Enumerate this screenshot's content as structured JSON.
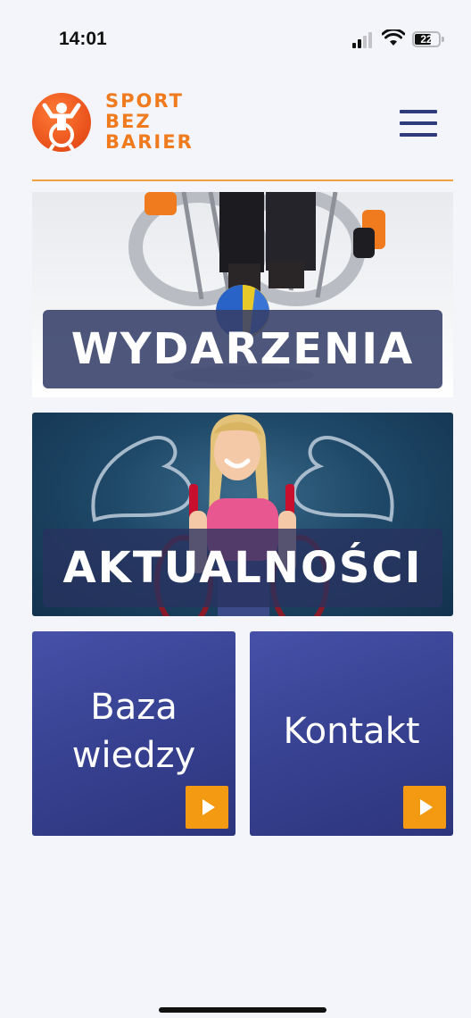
{
  "status_bar": {
    "time": "14:01",
    "battery": "22",
    "icons": [
      "signal-icon",
      "wifi-icon",
      "battery-icon"
    ]
  },
  "header": {
    "logo_lines": [
      "SPORT",
      "BEZ",
      "BARIER"
    ],
    "logo_icon": "athlete-wheelchair-icon",
    "menu_icon": "hamburger-menu-icon",
    "accent_color": "#f07a1e",
    "brand_color": "#2f3b7a"
  },
  "tiles": [
    {
      "label": "WYDARZENIA",
      "image": "wheelchair-athlete-ball-photo"
    },
    {
      "label": "AKTUALNOŚCI",
      "image": "girl-wheelchair-muscles-photo"
    }
  ],
  "boxes": [
    {
      "label_lines": [
        "Baza",
        "wiedzy"
      ],
      "arrow_icon": "play-arrow-icon"
    },
    {
      "label_lines": [
        "Kontakt"
      ],
      "arrow_icon": "play-arrow-icon"
    }
  ],
  "colors": {
    "box_blue": "#3a4496",
    "arrow_orange": "#f39a12",
    "divider": "#f0a040"
  }
}
